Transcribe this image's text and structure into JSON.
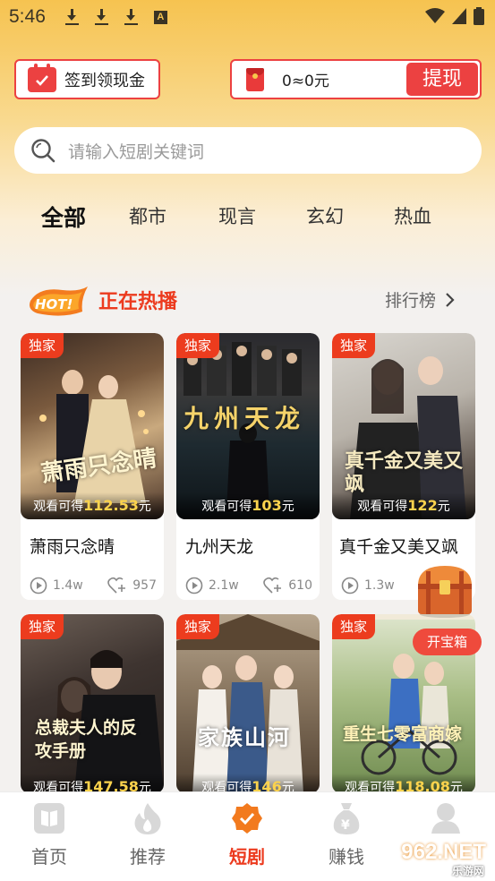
{
  "status_bar": {
    "time": "5:46"
  },
  "header": {
    "signin_label": "签到领现金",
    "balance": "0≈0元",
    "withdraw_label": "提现"
  },
  "search": {
    "placeholder": "请输入短剧关键词"
  },
  "categories": [
    "全部",
    "都市",
    "现言",
    "玄幻",
    "热血"
  ],
  "section": {
    "hot_badge": "HOT!",
    "title": "正在热播",
    "rank_label": "排行榜"
  },
  "cards": [
    {
      "tag": "独家",
      "earn_prefix": "观看可得",
      "earn_amount": "112.53",
      "earn_unit": "元",
      "title": "萧雨只念晴",
      "views": "1.4w",
      "likes": "957",
      "poster_text": "萧雨只念晴"
    },
    {
      "tag": "独家",
      "earn_prefix": "观看可得",
      "earn_amount": "103",
      "earn_unit": "元",
      "title": "九州天龙",
      "views": "2.1w",
      "likes": "610",
      "poster_text": "九州天龙"
    },
    {
      "tag": "独家",
      "earn_prefix": "观看可得",
      "earn_amount": "122",
      "earn_unit": "元",
      "title": "真千金又美又飒",
      "views": "1.3w",
      "likes": "",
      "poster_text": "真千金又美又飒"
    },
    {
      "tag": "独家",
      "earn_prefix": "观看可得",
      "earn_amount": "147.58",
      "earn_unit": "元",
      "poster_text": "总裁夫人的反攻手册"
    },
    {
      "tag": "独家",
      "earn_prefix": "观看可得",
      "earn_amount": "146",
      "earn_unit": "元",
      "poster_text": "家族山河"
    },
    {
      "tag": "独家",
      "earn_prefix": "观看可得",
      "earn_amount": "118.08",
      "earn_unit": "元",
      "poster_text": "重生七零富商嫁"
    }
  ],
  "treasure": {
    "label": "开宝箱"
  },
  "bottom_nav": [
    "首页",
    "推荐",
    "短剧",
    "赚钱",
    "我的"
  ],
  "watermark": {
    "logo": "962.NET",
    "sub": "乐游网"
  },
  "colors": {
    "accent": "#ec3a1e",
    "header_bg": "#f6c350"
  }
}
